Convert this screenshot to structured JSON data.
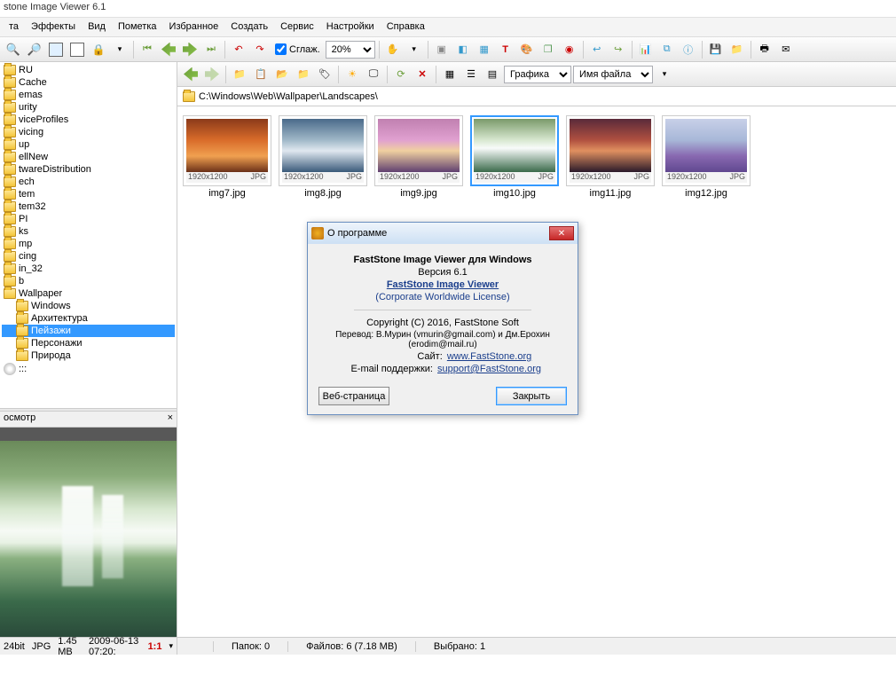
{
  "app": {
    "title": "stone Image Viewer 6.1"
  },
  "menu": [
    "та",
    "Эффекты",
    "Вид",
    "Пометка",
    "Избранное",
    "Создать",
    "Сервис",
    "Настройки",
    "Справка"
  ],
  "toolbar1": {
    "smooth_label": "Сглаж.",
    "zoom_value": "20%"
  },
  "toolbar2": {
    "style_label": "Графика",
    "sort_label": "Имя файла"
  },
  "path": "C:\\Windows\\Web\\Wallpaper\\Landscapes\\",
  "tree": [
    {
      "label": "RU",
      "icon": "folder",
      "indent": 0
    },
    {
      "label": "Cache",
      "icon": "folder",
      "indent": 0
    },
    {
      "label": "emas",
      "icon": "folder",
      "indent": 0
    },
    {
      "label": "urity",
      "icon": "folder",
      "indent": 0
    },
    {
      "label": "viceProfiles",
      "icon": "folder",
      "indent": 0
    },
    {
      "label": "vicing",
      "icon": "folder",
      "indent": 0
    },
    {
      "label": "up",
      "icon": "folder",
      "indent": 0
    },
    {
      "label": "ellNew",
      "icon": "folder",
      "indent": 0
    },
    {
      "label": "twareDistribution",
      "icon": "folder",
      "indent": 0
    },
    {
      "label": "ech",
      "icon": "folder",
      "indent": 0
    },
    {
      "label": "tem",
      "icon": "folder",
      "indent": 0
    },
    {
      "label": "tem32",
      "icon": "folder",
      "indent": 0
    },
    {
      "label": "PI",
      "icon": "folder",
      "indent": 0
    },
    {
      "label": "ks",
      "icon": "folder",
      "indent": 0
    },
    {
      "label": "mp",
      "icon": "folder",
      "indent": 0
    },
    {
      "label": "cing",
      "icon": "folder",
      "indent": 0
    },
    {
      "label": "in_32",
      "icon": "folder",
      "indent": 0
    },
    {
      "label": "b",
      "icon": "folder",
      "indent": 0
    },
    {
      "label": "Wallpaper",
      "icon": "folder",
      "indent": 0
    },
    {
      "label": "Windows",
      "icon": "folder",
      "indent": 1
    },
    {
      "label": "Архитектура",
      "icon": "folder",
      "indent": 1
    },
    {
      "label": "Пейзажи",
      "icon": "folder",
      "indent": 1,
      "selected": true
    },
    {
      "label": "Персонажи",
      "icon": "folder",
      "indent": 1
    },
    {
      "label": "Природа",
      "icon": "folder",
      "indent": 1
    },
    {
      "label": ":::",
      "icon": "cd",
      "indent": 0
    }
  ],
  "preview": {
    "title": "осмотр"
  },
  "statusleft": {
    "bits": "24bit",
    "format": "JPG",
    "size": "1.45 MB",
    "date": "2009-06-13 07:20:",
    "ratio": "1:1"
  },
  "thumbs": [
    {
      "name": "img7.jpg",
      "dim": "1920x1200",
      "fmt": "JPG",
      "bg": "linear-gradient(180deg,#8b3a1a 0%,#d96c2a 40%,#f0a050 70%,#6a3018 100%)"
    },
    {
      "name": "img8.jpg",
      "dim": "1920x1200",
      "fmt": "JPG",
      "bg": "linear-gradient(180deg,#4a6a8a 0%,#a0b8c8 40%,#e0e8f0 60%,#3a5a7a 100%)"
    },
    {
      "name": "img9.jpg",
      "dim": "1920x1200",
      "fmt": "JPG",
      "bg": "linear-gradient(180deg,#c080b0 0%,#e0a0d0 40%,#f0d0a0 60%,#604070 100%)"
    },
    {
      "name": "img10.jpg",
      "dim": "1920x1200",
      "fmt": "JPG",
      "bg": "linear-gradient(180deg,#7a9a6a 0%,#d8e8d0 40%,#f8fbfa 55%,#3a6a4a 100%)",
      "selected": true
    },
    {
      "name": "img11.jpg",
      "dim": "1920x1200",
      "fmt": "JPG",
      "bg": "linear-gradient(180deg,#5a2a3a 0%,#b05040 40%,#e09060 60%,#2a1a2a 100%)"
    },
    {
      "name": "img12.jpg",
      "dim": "1920x1200",
      "fmt": "JPG",
      "bg": "linear-gradient(180deg,#c8d0e8 0%,#a8b8d8 40%,#8868b0 70%,#604890 100%)"
    }
  ],
  "status": {
    "folders": "Папок: 0",
    "files": "Файлов: 6 (7.18 MB)",
    "selected": "Выбрано: 1"
  },
  "about": {
    "title": "О программе",
    "heading": "FastStone Image Viewer для Windows",
    "version": "Версия 6.1",
    "product": "FastStone Image Viewer",
    "license": "(Corporate Worldwide License)",
    "copyright": "Copyright (C) 2016, FastStone Soft",
    "translation": "Перевод: В.Мурин (vmurin@gmail.com) и Дм.Ерохин (erodim@mail.ru)",
    "site_label": "Сайт:",
    "site_link": "www.FastStone.org",
    "email_label": "E-mail поддержки:",
    "email_link": "support@FastStone.org",
    "btn_web": "Веб-страница",
    "btn_close": "Закрыть"
  }
}
